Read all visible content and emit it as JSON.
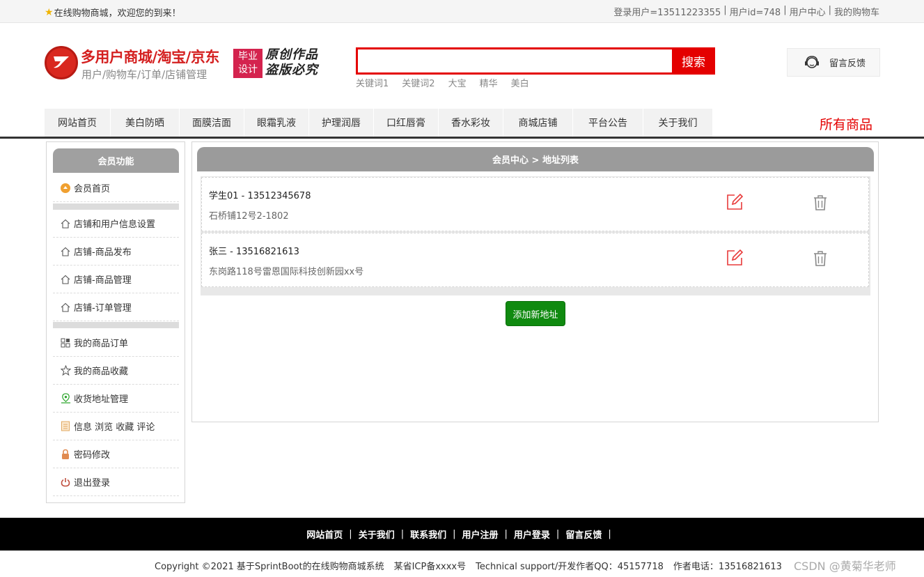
{
  "topbar": {
    "welcome": "在线购物商城，欢迎您的到来！",
    "links": [
      "登录用户=13511223355",
      "用户id=748",
      "用户中心",
      "我的购物车"
    ]
  },
  "header": {
    "title": "多用户商城/淘宝/京东",
    "subtitle": "用户/购物车/订单/店铺管理",
    "stamp": [
      "毕业",
      "设计"
    ],
    "calligraphy": [
      "原创作品",
      "盗版必究"
    ],
    "search": {
      "placeholder": "",
      "button": "搜索"
    },
    "keywords": [
      "关键词1",
      "关键词2",
      "大宝",
      "精华",
      "美白"
    ],
    "feedback": "留言反馈"
  },
  "nav": {
    "items": [
      "网站首页",
      "美白防晒",
      "面膜洁面",
      "眼霜乳液",
      "护理润唇",
      "口红唇膏",
      "香水彩妆",
      "商城店铺",
      "平台公告",
      "关于我们"
    ],
    "all_goods": "所有商品"
  },
  "sidebar": {
    "title": "会员功能",
    "items": [
      {
        "label": "会员首页",
        "icon": "member-home-icon"
      },
      {
        "label": "店铺和用户信息设置",
        "icon": "home-outline-icon"
      },
      {
        "label": "店铺-商品发布",
        "icon": "home-outline-icon"
      },
      {
        "label": "店铺-商品管理",
        "icon": "home-outline-icon"
      },
      {
        "label": "店铺-订单管理",
        "icon": "home-outline-icon"
      },
      {
        "label": "我的商品订单",
        "icon": "grid-icon"
      },
      {
        "label": "我的商品收藏",
        "icon": "star-icon"
      },
      {
        "label": "收货地址管理",
        "icon": "location-icon"
      },
      {
        "label": "信息 浏览 收藏 评论",
        "icon": "document-icon"
      },
      {
        "label": "密码修改",
        "icon": "lock-icon"
      },
      {
        "label": "退出登录",
        "icon": "power-icon"
      }
    ]
  },
  "main": {
    "title": "会员中心 > 地址列表",
    "addresses": [
      {
        "name": "学生01 - 13512345678",
        "address": "石桥铺12号2-1802"
      },
      {
        "name": "张三 - 13516821613",
        "address": "东岗路118号雷恩国际科技创新园xx号"
      }
    ],
    "add_button": "添加新地址"
  },
  "footer": {
    "links": [
      "网站首页",
      "关于我们",
      "联系我们",
      "用户注册",
      "用户登录",
      "留言反馈"
    ],
    "copyright": [
      "Copyright ©2021 基于SprintBoot的在线购物商城系统",
      "某省ICP备xxxx号",
      "Technical support/开发作者QQ：45157718",
      "作者电话：13516821613"
    ],
    "watermark": "CSDN @黄菊华老师"
  },
  "colors": {
    "brand_red": "#e40000",
    "add_green": "#108a10",
    "panel_gray": "#9b9b9b"
  }
}
